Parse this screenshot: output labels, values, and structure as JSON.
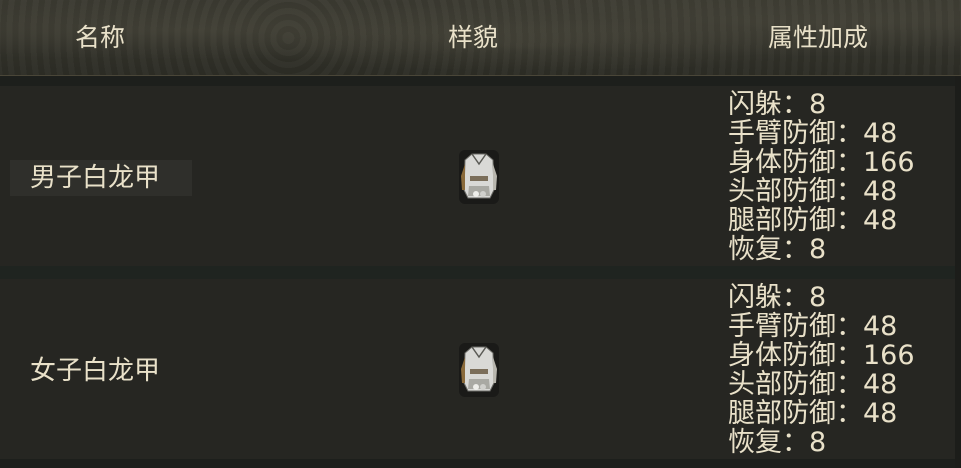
{
  "header": {
    "name_label": "名称",
    "look_label": "样貌",
    "attr_label": "属性加成"
  },
  "rows": [
    {
      "name": "男子白龙甲",
      "icon": "white-dragon-armor-icon",
      "attributes": [
        "闪躲：8",
        "手臂防御：48",
        "身体防御：166",
        "头部防御：48",
        "腿部防御：48",
        "恢复：8"
      ]
    },
    {
      "name": "女子白龙甲",
      "icon": "white-dragon-armor-icon",
      "attributes": [
        "闪躲：8",
        "手臂防御：48",
        "身体防御：166",
        "头部防御：48",
        "腿部防御：48",
        "恢复：8"
      ]
    }
  ],
  "colors": {
    "text": "#e9e1c9",
    "row_bg": "#262622",
    "header_bg": "#35342c"
  }
}
